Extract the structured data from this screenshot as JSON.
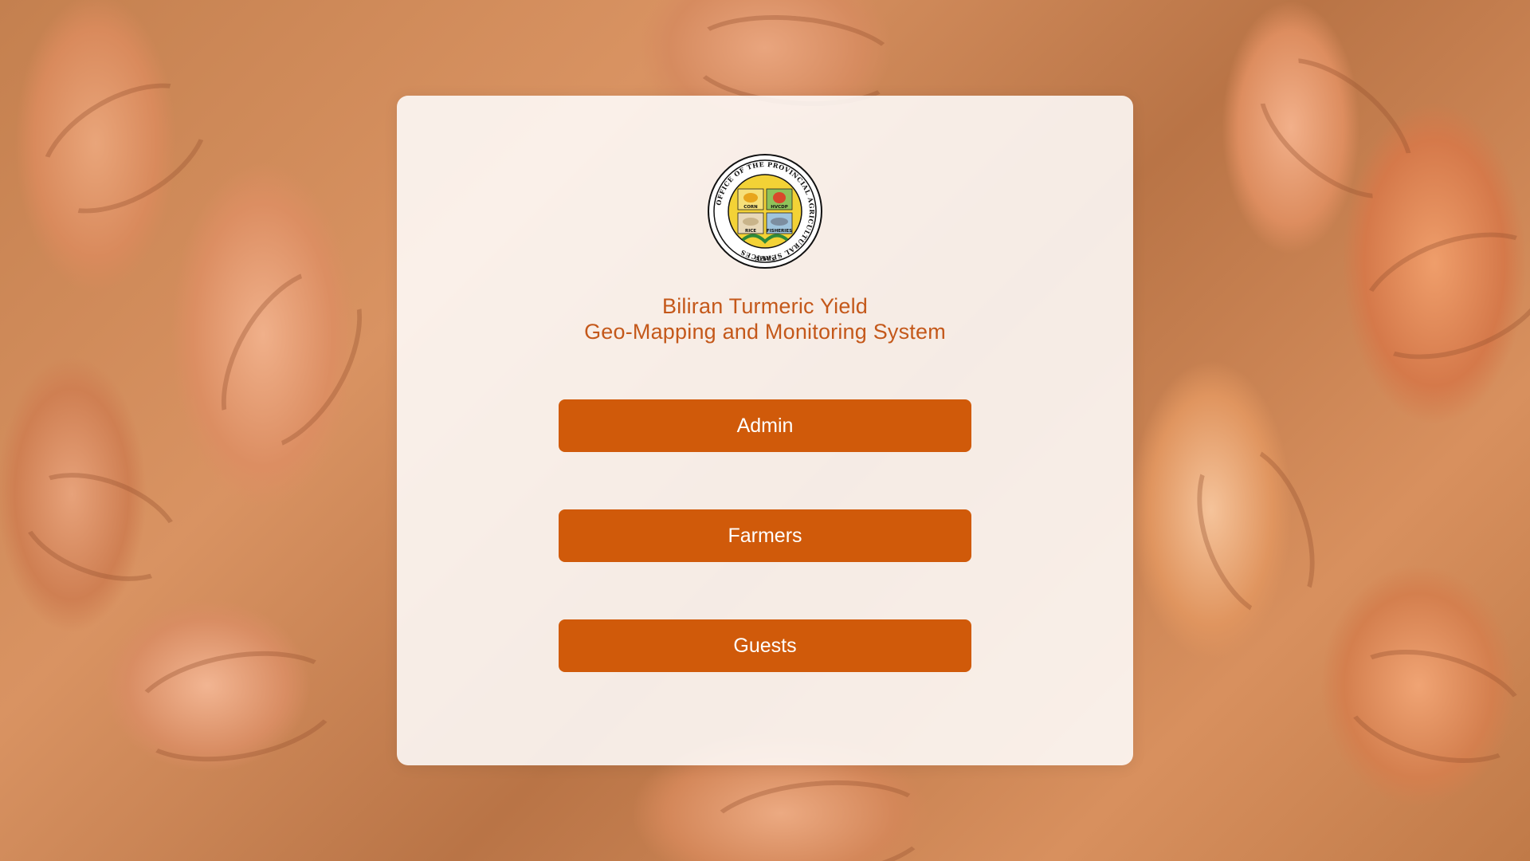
{
  "theme": {
    "accent": "#d05a0a",
    "title_color": "#c4581a",
    "card_background": "#ffffff"
  },
  "logo": {
    "seal_text": "OFFICE OF THE PROVINCIAL AGRICULTURAL SERVICES",
    "bottom_text": "AEW's",
    "quadrants": [
      "CORN",
      "HVCDP",
      "RICE",
      "FISHERIES"
    ]
  },
  "title": {
    "line1": "Biliran Turmeric Yield",
    "line2": "Geo-Mapping and Monitoring System"
  },
  "buttons": {
    "admin": "Admin",
    "farmers": "Farmers",
    "guests": "Guests"
  }
}
